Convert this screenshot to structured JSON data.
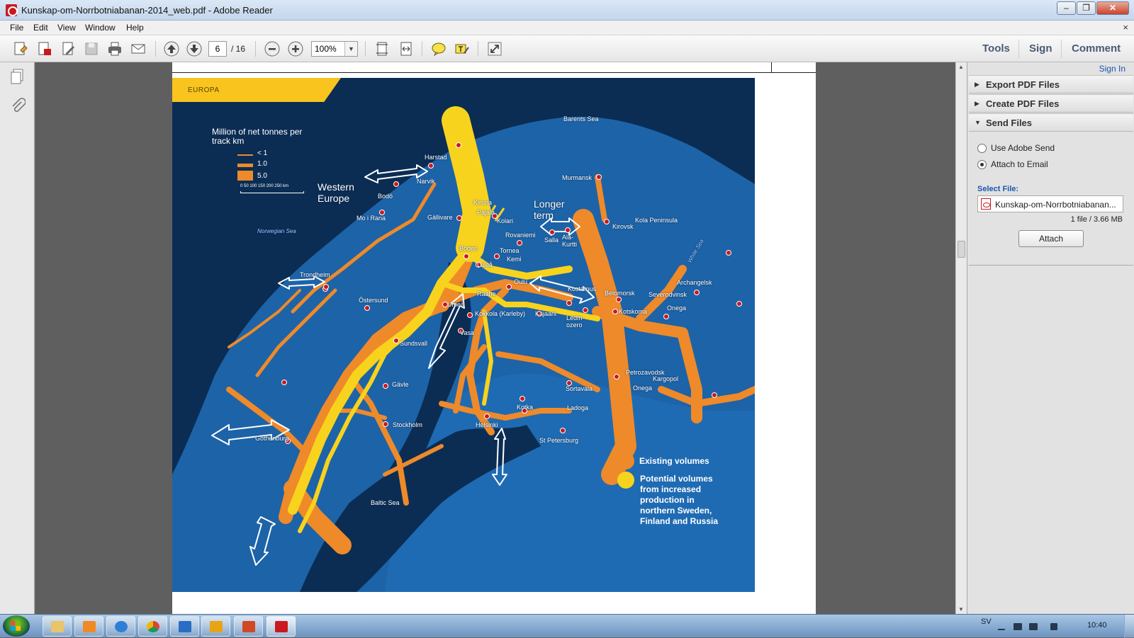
{
  "window": {
    "title": "Kunskap-om-Norrbotniabanan-2014_web.pdf - Adobe Reader",
    "buttons": {
      "minimize": "–",
      "maximize": "❐",
      "close": "✕"
    }
  },
  "menubar": {
    "items": [
      "File",
      "Edit",
      "View",
      "Window",
      "Help"
    ],
    "close_label": "×"
  },
  "toolbar": {
    "page_current": "6",
    "page_total": "/ 16",
    "zoom": "100%",
    "tools_label": "Tools",
    "sign_label": "Sign",
    "comment_label": "Comment"
  },
  "document": {
    "tag": "EUROPA",
    "legend": {
      "title": "Million of net tonnes per track km",
      "rows": [
        "< 1",
        "1.0",
        "5.0"
      ],
      "scale": "0   50  100  150  200  250 km"
    },
    "callouts": {
      "western_europe": "Western Europe",
      "longer_term": "Longer term"
    },
    "volumes": {
      "existing": "Existing volumes",
      "potential": "Potential volumes from increased production in northern Sweden, Finland and Russia",
      "existing_color": "#ee8a2a",
      "potential_color": "#f8d31d"
    },
    "places": {
      "barents_sea": "Barents Sea",
      "harstad": "Harstad",
      "narvik": "Narvik",
      "bodo": "Bodö",
      "mo_i_rana": "Mo i Rana",
      "norwegian_sea": "Norwegian Sea",
      "gallivare": "Gällivare",
      "kiruna": "Kiruna",
      "pajala": "Pajala",
      "kolari": "Kolari",
      "murmansk": "Murmansk",
      "kirovsk": "Kirovsk",
      "kola_peninsula": "Kola Peninsula",
      "rovaniemi": "Rovaniemi",
      "salla": "Salla",
      "ala_kurtti": "Ala-Kurtti",
      "boden": "Boden",
      "lulea": "Luleå",
      "tornea": "Tornea",
      "kemi": "Kemi",
      "white_sea": "White Sea",
      "archangelsk": "Archangelsk",
      "severodvinsk": "Severodvinsk",
      "trondheim": "Trondheim",
      "raahe": "Raahe",
      "oulu": "Oulu",
      "kostamus": "Kostamus",
      "belomorsk": "Belomorsk",
      "ostersund": "Östersund",
      "umea": "Umeå",
      "kokkola": "Kokkola (Karleby)",
      "kajaani": "Kajaani",
      "ledmozero": "Ledm-ozero",
      "kotskoma": "Kotskoma",
      "onega": "Onega",
      "vasa": "Vasa",
      "sundsvall": "Sundsvall",
      "petrozavodsk": "Petrozavodsk",
      "kargopol": "Kargopol",
      "onega_lake": "Onega",
      "gavle": "Gävle",
      "sortavala": "Sortavala",
      "ladoga": "Ladoga",
      "kotka": "Kotka",
      "stockholm": "Stockholm",
      "helsinki": "Helsinki",
      "st_petersburg": "St Petersburg",
      "gothenburg": "Gothenburg",
      "baltic_sea": "Baltic Sea"
    }
  },
  "rightpane": {
    "sign_in": "Sign In",
    "sections": [
      "Export PDF Files",
      "Create PDF Files",
      "Send Files"
    ],
    "send": {
      "option_adobe_send": "Use Adobe Send",
      "option_attach_email": "Attach to Email",
      "selected_option": "Attach to Email",
      "select_file_label": "Select File:",
      "file_name": "Kunskap-om-Norrbotniabanan...",
      "file_info": "1 file / 3.66 MB",
      "attach_button": "Attach"
    }
  },
  "taskbar": {
    "language": "SV",
    "time": "10:40"
  }
}
